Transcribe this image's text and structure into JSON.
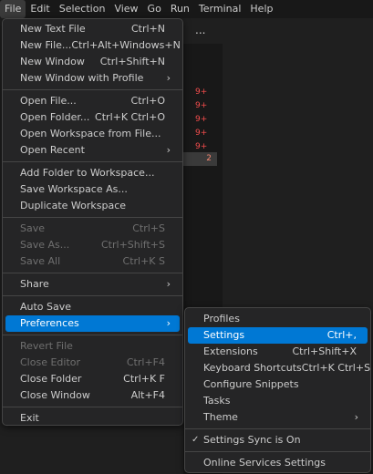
{
  "menubar": [
    "File",
    "Edit",
    "Selection",
    "View",
    "Go",
    "Run",
    "Terminal",
    "Help"
  ],
  "editor": {
    "more": "...",
    "problem_counts": [
      "9+",
      "9+",
      "9+",
      "9+",
      "9+"
    ],
    "problem_two": "2"
  },
  "file_menu": {
    "new_text_file": {
      "label": "New Text File",
      "kb": "Ctrl+N"
    },
    "new_file": {
      "label": "New File...",
      "kb": "Ctrl+Alt+Windows+N"
    },
    "new_window": {
      "label": "New Window",
      "kb": "Ctrl+Shift+N"
    },
    "new_window_profile": {
      "label": "New Window with Profile"
    },
    "open_file": {
      "label": "Open File...",
      "kb": "Ctrl+O"
    },
    "open_folder": {
      "label": "Open Folder...",
      "kb": "Ctrl+K Ctrl+O"
    },
    "open_workspace": {
      "label": "Open Workspace from File..."
    },
    "open_recent": {
      "label": "Open Recent"
    },
    "add_folder": {
      "label": "Add Folder to Workspace..."
    },
    "save_workspace_as": {
      "label": "Save Workspace As..."
    },
    "duplicate_workspace": {
      "label": "Duplicate Workspace"
    },
    "save": {
      "label": "Save",
      "kb": "Ctrl+S"
    },
    "save_as": {
      "label": "Save As...",
      "kb": "Ctrl+Shift+S"
    },
    "save_all": {
      "label": "Save All",
      "kb": "Ctrl+K S"
    },
    "share": {
      "label": "Share"
    },
    "auto_save": {
      "label": "Auto Save"
    },
    "preferences": {
      "label": "Preferences"
    },
    "revert_file": {
      "label": "Revert File"
    },
    "close_editor": {
      "label": "Close Editor",
      "kb": "Ctrl+F4"
    },
    "close_folder": {
      "label": "Close Folder",
      "kb": "Ctrl+K F"
    },
    "close_window": {
      "label": "Close Window",
      "kb": "Alt+F4"
    },
    "exit": {
      "label": "Exit"
    }
  },
  "pref_menu": {
    "profiles": {
      "label": "Profiles"
    },
    "settings": {
      "label": "Settings",
      "kb": "Ctrl+,"
    },
    "extensions": {
      "label": "Extensions",
      "kb": "Ctrl+Shift+X"
    },
    "keyboard_shortcuts": {
      "label": "Keyboard Shortcuts",
      "kb": "Ctrl+K Ctrl+S"
    },
    "configure_snippets": {
      "label": "Configure Snippets"
    },
    "tasks": {
      "label": "Tasks"
    },
    "theme": {
      "label": "Theme"
    },
    "settings_sync": {
      "label": "Settings Sync is On"
    },
    "online_services": {
      "label": "Online Services Settings"
    }
  },
  "glyphs": {
    "chevron": "›",
    "check": "✓"
  },
  "colors": {
    "accent": "#0078d4",
    "menu_bg": "#252526",
    "error": "#f14c4c"
  }
}
